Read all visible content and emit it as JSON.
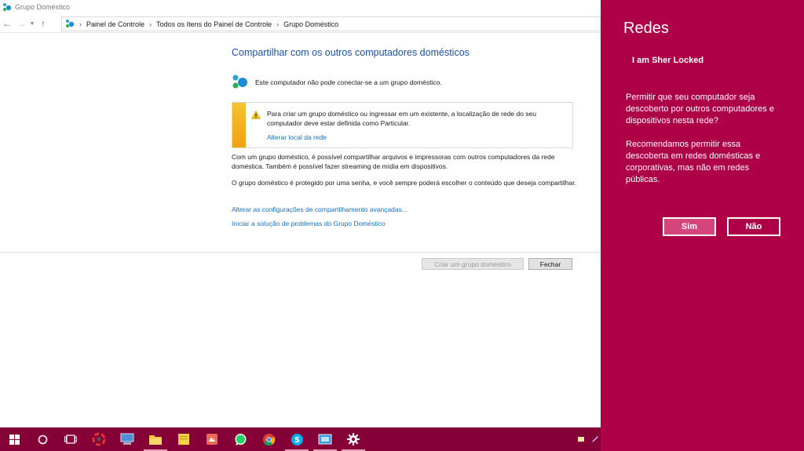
{
  "window": {
    "title": "Grupo Doméstico",
    "breadcrumbs": [
      "Painel de Controle",
      "Todos os Itens do Painel de Controle",
      "Grupo Doméstico"
    ]
  },
  "main": {
    "heading": "Compartilhar com os outros computadores domésticos",
    "status": "Este computador não pode conectar-se a um grupo doméstico.",
    "warning": {
      "message": "Para criar um grupo doméstico ou ingressar em um existente, a localização de rede do seu computador deve estar definida como Particular.",
      "link": "Alterar local da rede"
    },
    "paragraph1": "Com um grupo doméstico, é possível compartilhar arquivos e impressoras com outros computadores da rede doméstica. Também é possível fazer streaming de mídia em dispositivos.",
    "paragraph2": "O grupo doméstico é protegido por uma senha, e você sempre poderá escolher o conteúdo que deseja compartilhar.",
    "link_advanced": "Alterar as configurações de compartilhamento avançadas...",
    "link_troubleshoot": "Iniciar a solução de problemas do Grupo Doméstico",
    "create_button": "Criar um grupo doméstico",
    "close_button": "Fechar"
  },
  "networks_panel": {
    "title": "Redes",
    "network_name": "I am Sher Locked",
    "question": "Permitir que seu computador seja descoberto por outros computadores e dispositivos nesta rede?",
    "recommendation": "Recomendamos permitir essa descoberta em redes domésticas e corporativas, mas não em redes públicas.",
    "yes_button": "Sim",
    "no_button": "Não",
    "accent_color": "#ad0047"
  },
  "taskbar": {
    "color": "#860038",
    "icons": [
      "windows-start-icon",
      "cortana-search-icon",
      "task-view-icon",
      "app-icon",
      "app-icon",
      "file-explorer-icon",
      "sticky-notes-icon",
      "app-icon",
      "whatsapp-icon",
      "chrome-icon",
      "skype-icon",
      "app-icon",
      "settings-gear-icon"
    ]
  }
}
